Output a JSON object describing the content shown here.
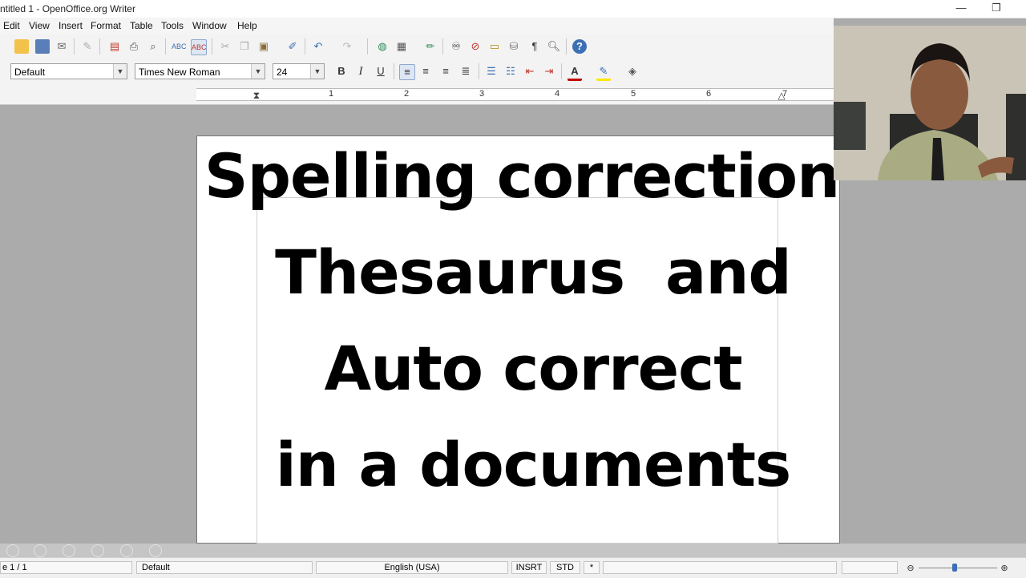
{
  "window": {
    "title": "ntitled 1 - OpenOffice.org Writer",
    "minimize": "—",
    "restore": "❐"
  },
  "menu": [
    "Edit",
    "View",
    "Insert",
    "Format",
    "Table",
    "Tools",
    "Window",
    "Help"
  ],
  "formatting": {
    "paragraph_style": "Default",
    "font_name": "Times New Roman",
    "font_size": "24",
    "bold": "B",
    "italic": "I",
    "underline": "U"
  },
  "ruler": {
    "numbers": [
      "1",
      "2",
      "3",
      "4",
      "5",
      "6",
      "7"
    ]
  },
  "document": {
    "lines": [
      "Spelling correction,",
      "Thesaurus  and",
      "Auto correct",
      "in a documents"
    ]
  },
  "status": {
    "page": "e 1 / 1",
    "page_style": "Default",
    "language": "English (USA)",
    "insert_mode": "INSRT",
    "selection_mode": "STD",
    "modified": "*"
  },
  "colors": {
    "accent": "#3c6fb4",
    "font_color": "#c00000",
    "highlight": "#ffe600"
  }
}
